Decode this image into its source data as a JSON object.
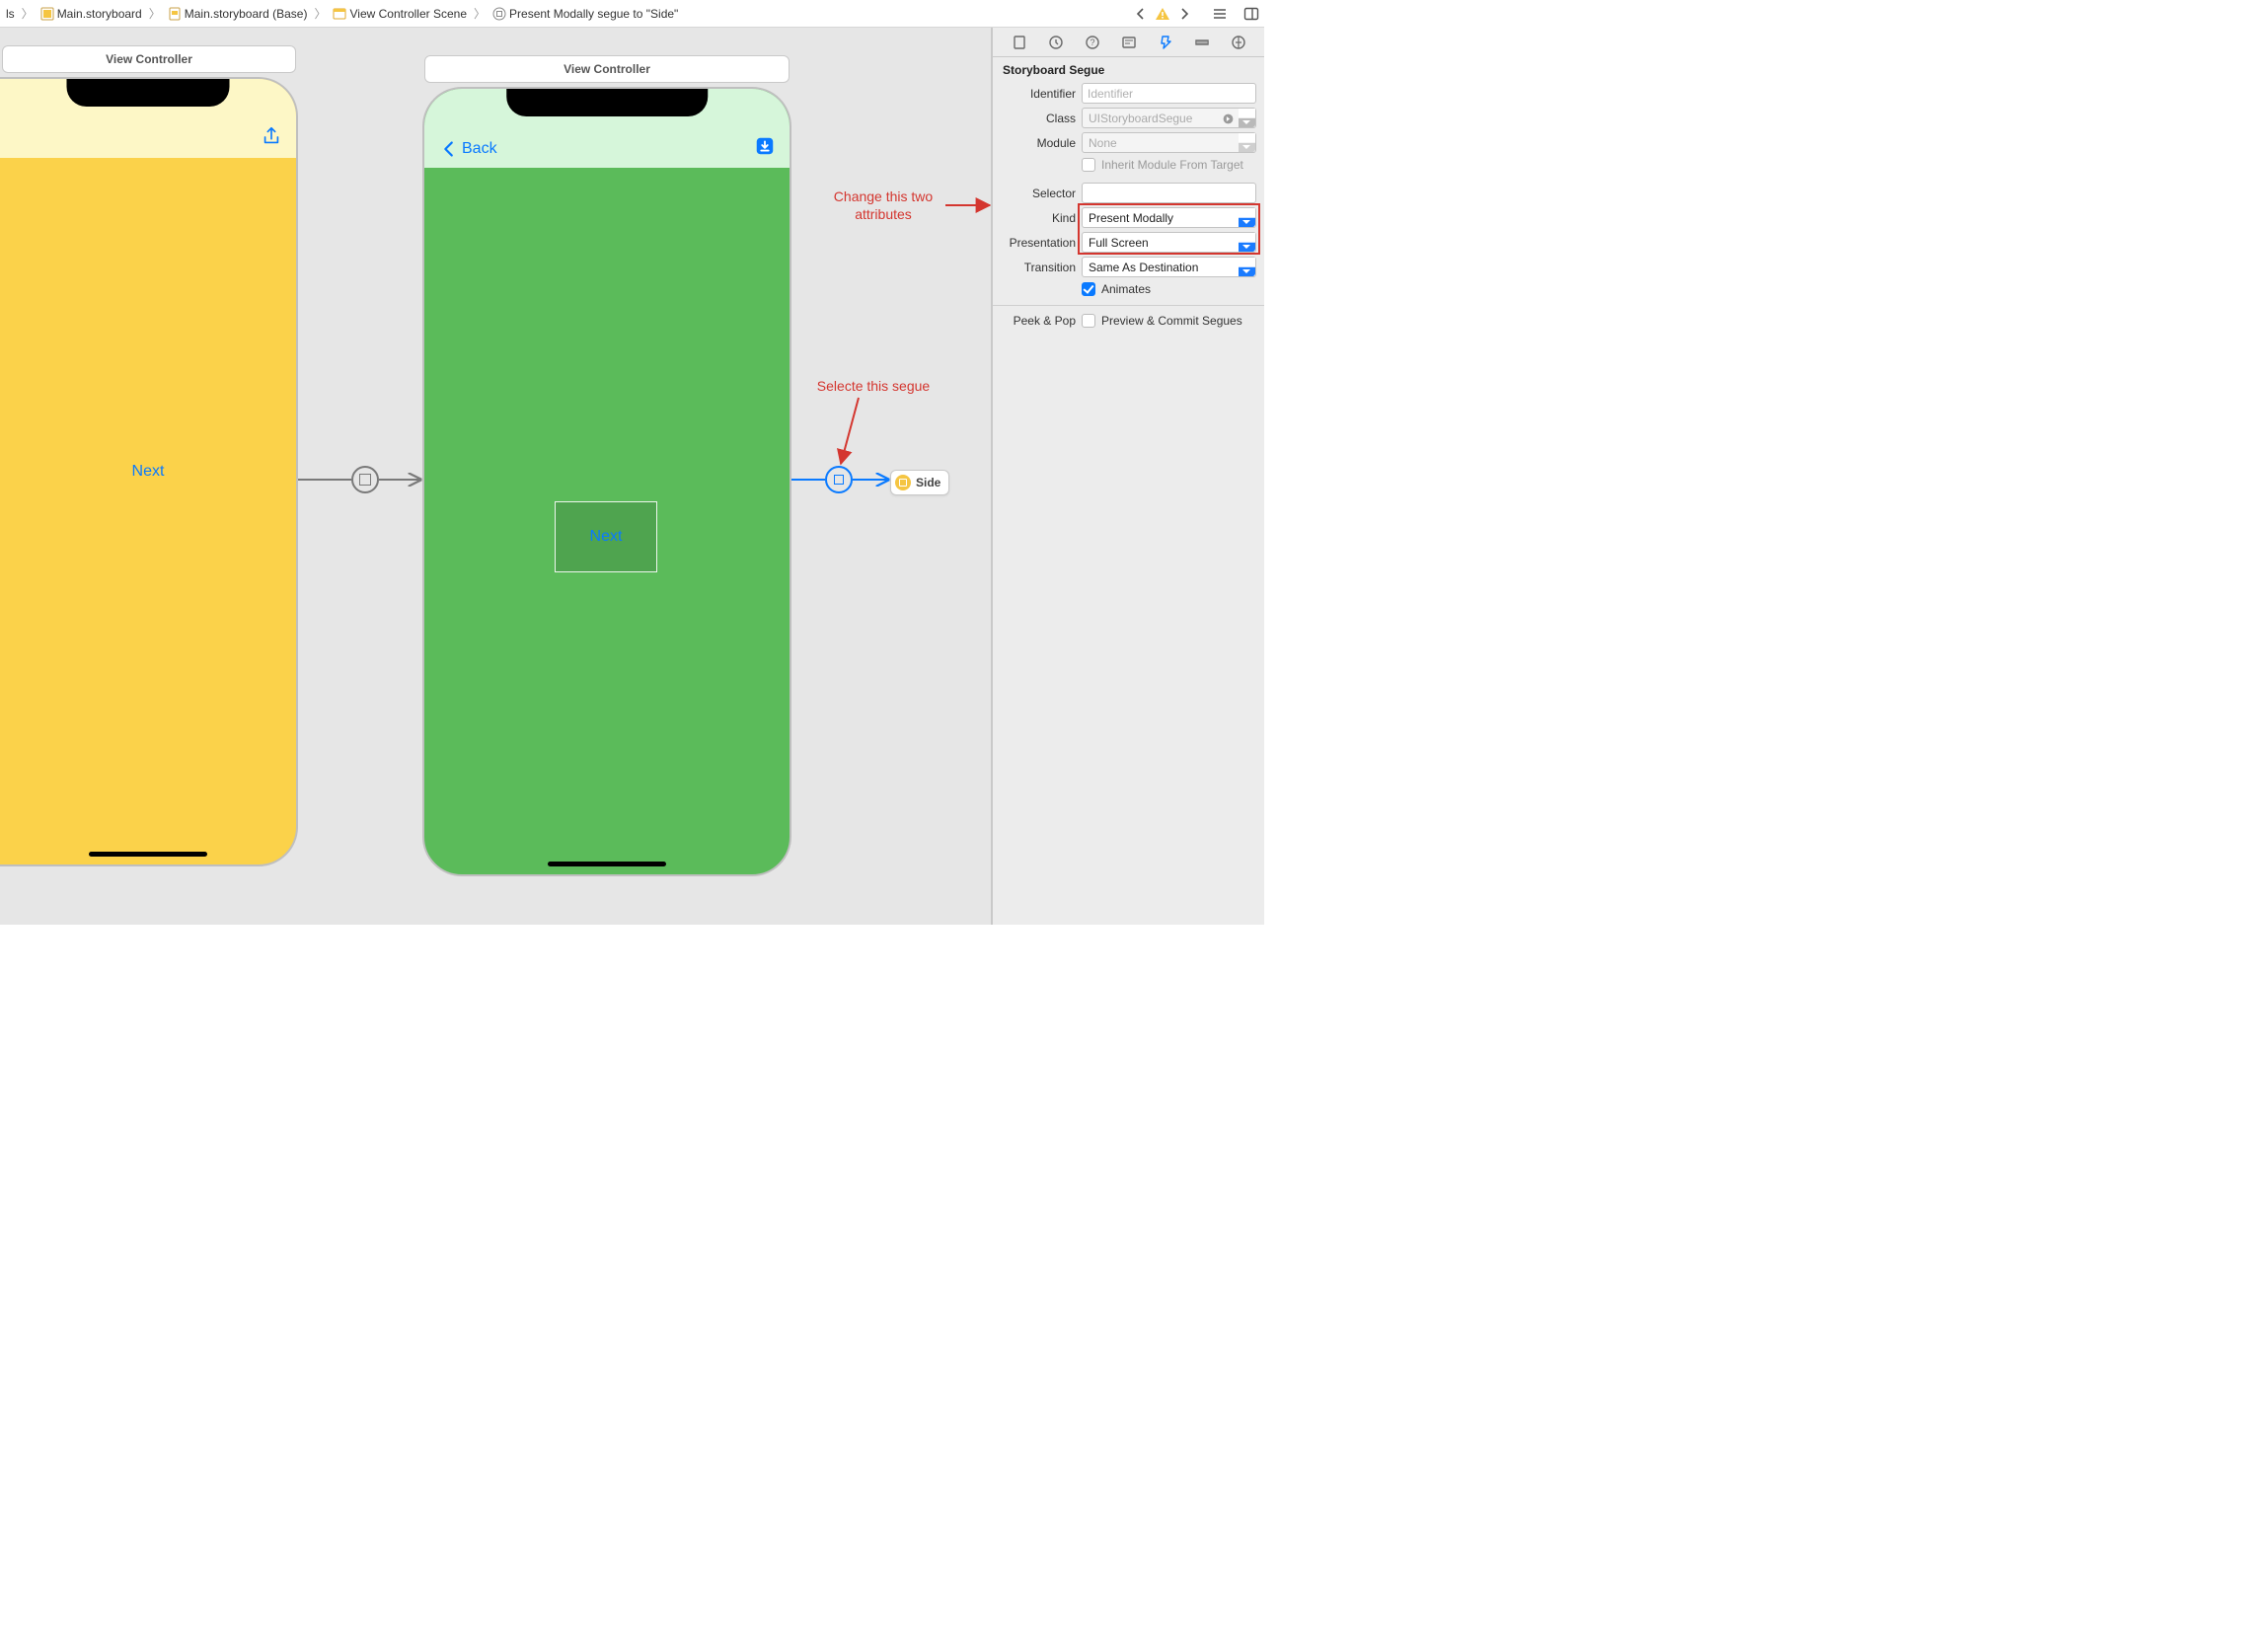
{
  "breadcrumbs": {
    "b0_partial": "ls",
    "b1": "Main.storyboard",
    "b2": "Main.storyboard (Base)",
    "b3": "View Controller Scene",
    "b4": "Present Modally segue to \"Side\""
  },
  "scenes": {
    "vc1_title": "View Controller",
    "vc2_title": "View Controller",
    "side_ref": "Side",
    "vc1_button": "Next",
    "vc2_button": "Next",
    "vc2_back": "Back"
  },
  "annotations": {
    "a1_line1": "Change this two",
    "a1_line2": "attributes",
    "a2": "Selecte this segue"
  },
  "inspector": {
    "section": "Storyboard Segue",
    "fields": {
      "identifier_label": "Identifier",
      "identifier_placeholder": "Identifier",
      "class_label": "Class",
      "class_value": "UIStoryboardSegue",
      "module_label": "Module",
      "module_value": "None",
      "inherit_label": "Inherit Module From Target",
      "selector_label": "Selector",
      "selector_value": "",
      "kind_label": "Kind",
      "kind_value": "Present Modally",
      "presentation_label": "Presentation",
      "presentation_value": "Full Screen",
      "transition_label": "Transition",
      "transition_value": "Same As Destination",
      "animates_label": "Animates",
      "peek_label": "Peek & Pop",
      "peek_option": "Preview & Commit Segues"
    }
  }
}
